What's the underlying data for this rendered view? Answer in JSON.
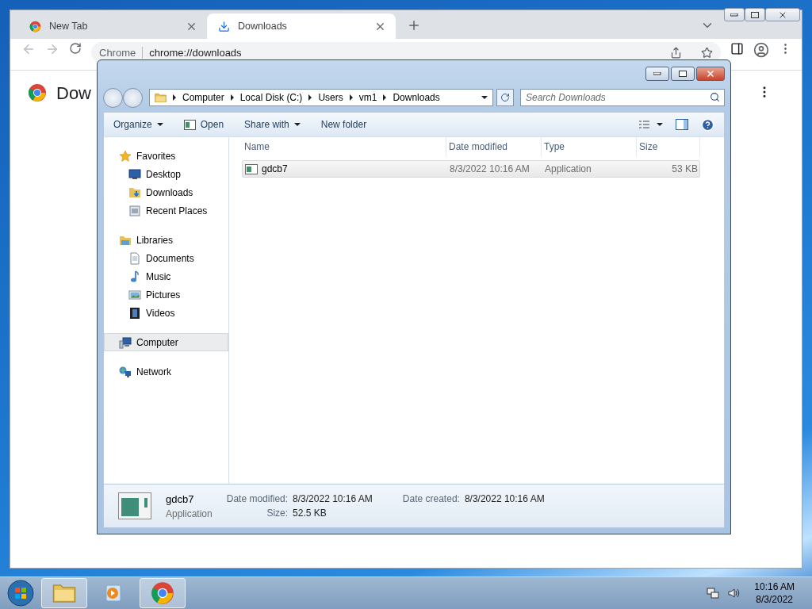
{
  "chrome": {
    "tabs": [
      {
        "label": "New Tab",
        "kind": "newtab",
        "selected": false
      },
      {
        "label": "Downloads",
        "kind": "downloads",
        "selected": true
      }
    ],
    "address": {
      "site": "Chrome",
      "url": "chrome://downloads"
    },
    "page_title": "Dow"
  },
  "explorer": {
    "breadcrumb": [
      "Computer",
      "Local Disk (C:)",
      "Users",
      "vm1",
      "Downloads"
    ],
    "search": {
      "placeholder": "Search Downloads"
    },
    "toolbar": [
      {
        "label": "Organize",
        "kind": "menu"
      },
      {
        "label": "Open",
        "kind": "icon"
      },
      {
        "label": "Share with",
        "kind": "menu"
      },
      {
        "label": "New folder",
        "kind": "plain"
      }
    ],
    "nav": [
      {
        "label": "Favorites",
        "kind": "star",
        "selected": false,
        "children": [
          {
            "label": "Desktop",
            "kind": "desktop",
            "selected": false
          },
          {
            "label": "Downloads",
            "kind": "downloads",
            "selected": false
          },
          {
            "label": "Recent Places",
            "kind": "recent",
            "selected": false
          }
        ]
      },
      {
        "label": "Libraries",
        "kind": "library",
        "selected": false,
        "children": [
          {
            "label": "Documents",
            "kind": "documents",
            "selected": false
          },
          {
            "label": "Music",
            "kind": "music",
            "selected": false
          },
          {
            "label": "Pictures",
            "kind": "pictures",
            "selected": false
          },
          {
            "label": "Videos",
            "kind": "videos",
            "selected": false
          }
        ]
      },
      {
        "label": "Computer",
        "kind": "computer",
        "selected": true
      },
      {
        "label": "Network",
        "kind": "network",
        "selected": false
      }
    ],
    "columns": [
      "Name",
      "Date modified",
      "Type",
      "Size"
    ],
    "files": [
      {
        "name": "gdcb7",
        "date_modified": "8/3/2022 10:16 AM",
        "type": "Application",
        "size": "53 KB",
        "selected": true
      }
    ],
    "details": {
      "name": "gdcb7",
      "type": "Application",
      "fields": [
        {
          "label": "Date modified:",
          "value": "8/3/2022 10:16 AM"
        },
        {
          "label": "Date created:",
          "value": "8/3/2022 10:16 AM"
        },
        {
          "label": "Size:",
          "value": "52.5 KB"
        }
      ]
    }
  },
  "taskbar": {
    "items": [
      {
        "kind": "explorer",
        "active": true
      },
      {
        "kind": "media",
        "active": false
      },
      {
        "kind": "chrome",
        "active": true
      }
    ],
    "time": "10:16 AM",
    "date": "8/3/2022"
  }
}
